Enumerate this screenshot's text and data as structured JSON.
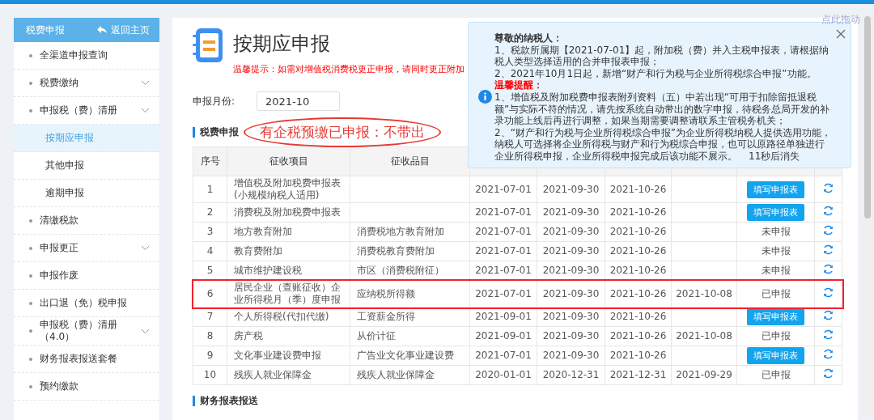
{
  "sidebar": {
    "title": "税费申报",
    "back_link": "返回主页",
    "items": [
      {
        "label": "全渠道申报查询",
        "expandable": false,
        "selected": false
      },
      {
        "label": "税费缴纳",
        "expandable": true,
        "selected": false
      },
      {
        "label": "申报税（费）清册",
        "expandable": true,
        "selected": false,
        "children": [
          {
            "label": "按期应申报",
            "selected": true
          },
          {
            "label": "其他申报",
            "selected": false
          },
          {
            "label": "逾期申报",
            "selected": false
          }
        ]
      },
      {
        "label": "清缴税款",
        "expandable": false,
        "selected": false
      },
      {
        "label": "申报更正",
        "expandable": true,
        "selected": false
      },
      {
        "label": "申报作废",
        "expandable": false,
        "selected": false
      },
      {
        "label": "出口退（免）税申报",
        "expandable": false,
        "selected": false
      },
      {
        "label": "申报税（费）清册（4.0）",
        "expandable": true,
        "selected": false
      },
      {
        "label": "财务报表报送套餐",
        "expandable": false,
        "selected": false
      },
      {
        "label": "预约缴款",
        "expandable": false,
        "selected": false
      }
    ]
  },
  "page": {
    "title": "按期应申报",
    "hint": "温馨提示：如需对增值税消费税更正申报，请同时更正附加",
    "month_label": "申报月份:",
    "month_value": "2021-10"
  },
  "drag_handle": "点此拖动",
  "section": {
    "title": "税费申报",
    "annotation": "有企税预缴已申报：不带出"
  },
  "table": {
    "columns": [
      "序号",
      "征收项目",
      "征收品目"
    ],
    "rows": [
      {
        "no": "1",
        "item": "增值税及附加税费申报表(小规模纳税人适用)",
        "column_4": "2021-07-01",
        "column_5": "2021-09-30",
        "column_6": "2021-10-26",
        "action": {
          "kind": "button",
          "label": "填写申报表"
        },
        "highlighted": false
      },
      {
        "no": "2",
        "item": "消费税及附加税费申报表",
        "column_4": "2021-07-01",
        "column_5": "2021-09-30",
        "column_6": "2021-10-26",
        "action": {
          "kind": "button",
          "label": "填写申报表"
        },
        "highlighted": false
      },
      {
        "no": "3",
        "item": "地方教育附加",
        "category": "消费税地方教育附加",
        "column_4": "2021-07-01",
        "column_5": "2021-09-30",
        "column_6": "2021-10-26",
        "action": {
          "kind": "status",
          "label": "未申报"
        },
        "highlighted": false
      },
      {
        "no": "4",
        "item": "教育费附加",
        "category": "消费税教育费附加",
        "column_4": "2021-07-01",
        "column_5": "2021-09-30",
        "column_6": "2021-10-26",
        "action": {
          "kind": "status",
          "label": "未申报"
        },
        "highlighted": false
      },
      {
        "no": "5",
        "item": "城市维护建设税",
        "category": "市区（消费税附征）",
        "column_4": "2021-07-01",
        "column_5": "2021-09-30",
        "column_6": "2021-10-26",
        "action": {
          "kind": "status",
          "label": "未申报"
        },
        "highlighted": false
      },
      {
        "no": "6",
        "item": "居民企业（查账征收）企业所得税月（季）度申报",
        "category": "应纳税所得额",
        "column_4": "2021-07-01",
        "column_5": "2021-09-30",
        "column_6": "2021-10-26",
        "column_7": "2021-10-08",
        "action": {
          "kind": "status",
          "label": "已申报"
        },
        "highlighted": true
      },
      {
        "no": "7",
        "item": "个人所得税(代扣代缴)",
        "category": "工资薪金所得",
        "column_4": "2021-09-01",
        "column_5": "2021-09-30",
        "column_6": "2021-10-26",
        "action": {
          "kind": "button",
          "label": "填写申报表"
        },
        "highlighted": false
      },
      {
        "no": "8",
        "item": "房产税",
        "category": "从价计征",
        "column_4": "2021-09-01",
        "column_5": "2021-09-30",
        "column_6": "2021-10-26",
        "column_7": "2021-10-08",
        "action": {
          "kind": "status",
          "label": "已申报"
        },
        "highlighted": false
      },
      {
        "no": "9",
        "item": "文化事业建设费申报",
        "category": "广告业文化事业建设费",
        "column_4": "2021-07-01",
        "column_5": "2021-09-30",
        "column_6": "2021-10-26",
        "action": {
          "kind": "button",
          "label": "填写申报表"
        },
        "highlighted": false
      },
      {
        "no": "10",
        "item": "残疾人就业保障金",
        "category": "残疾人就业保障金",
        "column_4": "2020-01-01",
        "column_5": "2020-12-31",
        "column_6": "2021-12-31",
        "column_7": "2021-09-29",
        "action": {
          "kind": "status",
          "label": "已申报"
        },
        "highlighted": false
      }
    ]
  },
  "next_section": {
    "title": "财务报表报送"
  },
  "notice": {
    "greeting": "尊敬的纳税人：",
    "lines": [
      "1、税款所属期【2021-07-01】起，附加税（费）并入主税申报表，请根据纳税人类型选择适用的合并申报表申报；",
      "2、2021年10月1日起，新增“财产和行为税与企业所得税综合申报”功能。"
    ],
    "reminder_title": "温馨提醒：",
    "reminders": [
      "1、增值税及附加税费申报表附列资料（五）中若出现“可用于扣除留抵退税额”与实际不符的情况，请先按系统自动带出的数字申报，待税务总局开发的补录功能上线后再进行调整，如果当期需要调整请联系主管税务机关；",
      "2、“财产和行为税与企业所得税综合申报”为企业所得税纳税人提供选用功能，纳税人可选择将企业所得税与财产和行为税综合申报，也可以原路径单独进行企业所得税申报，企业所得税申报完成后该功能不展示。"
    ],
    "countdown": "11秒后消失"
  }
}
